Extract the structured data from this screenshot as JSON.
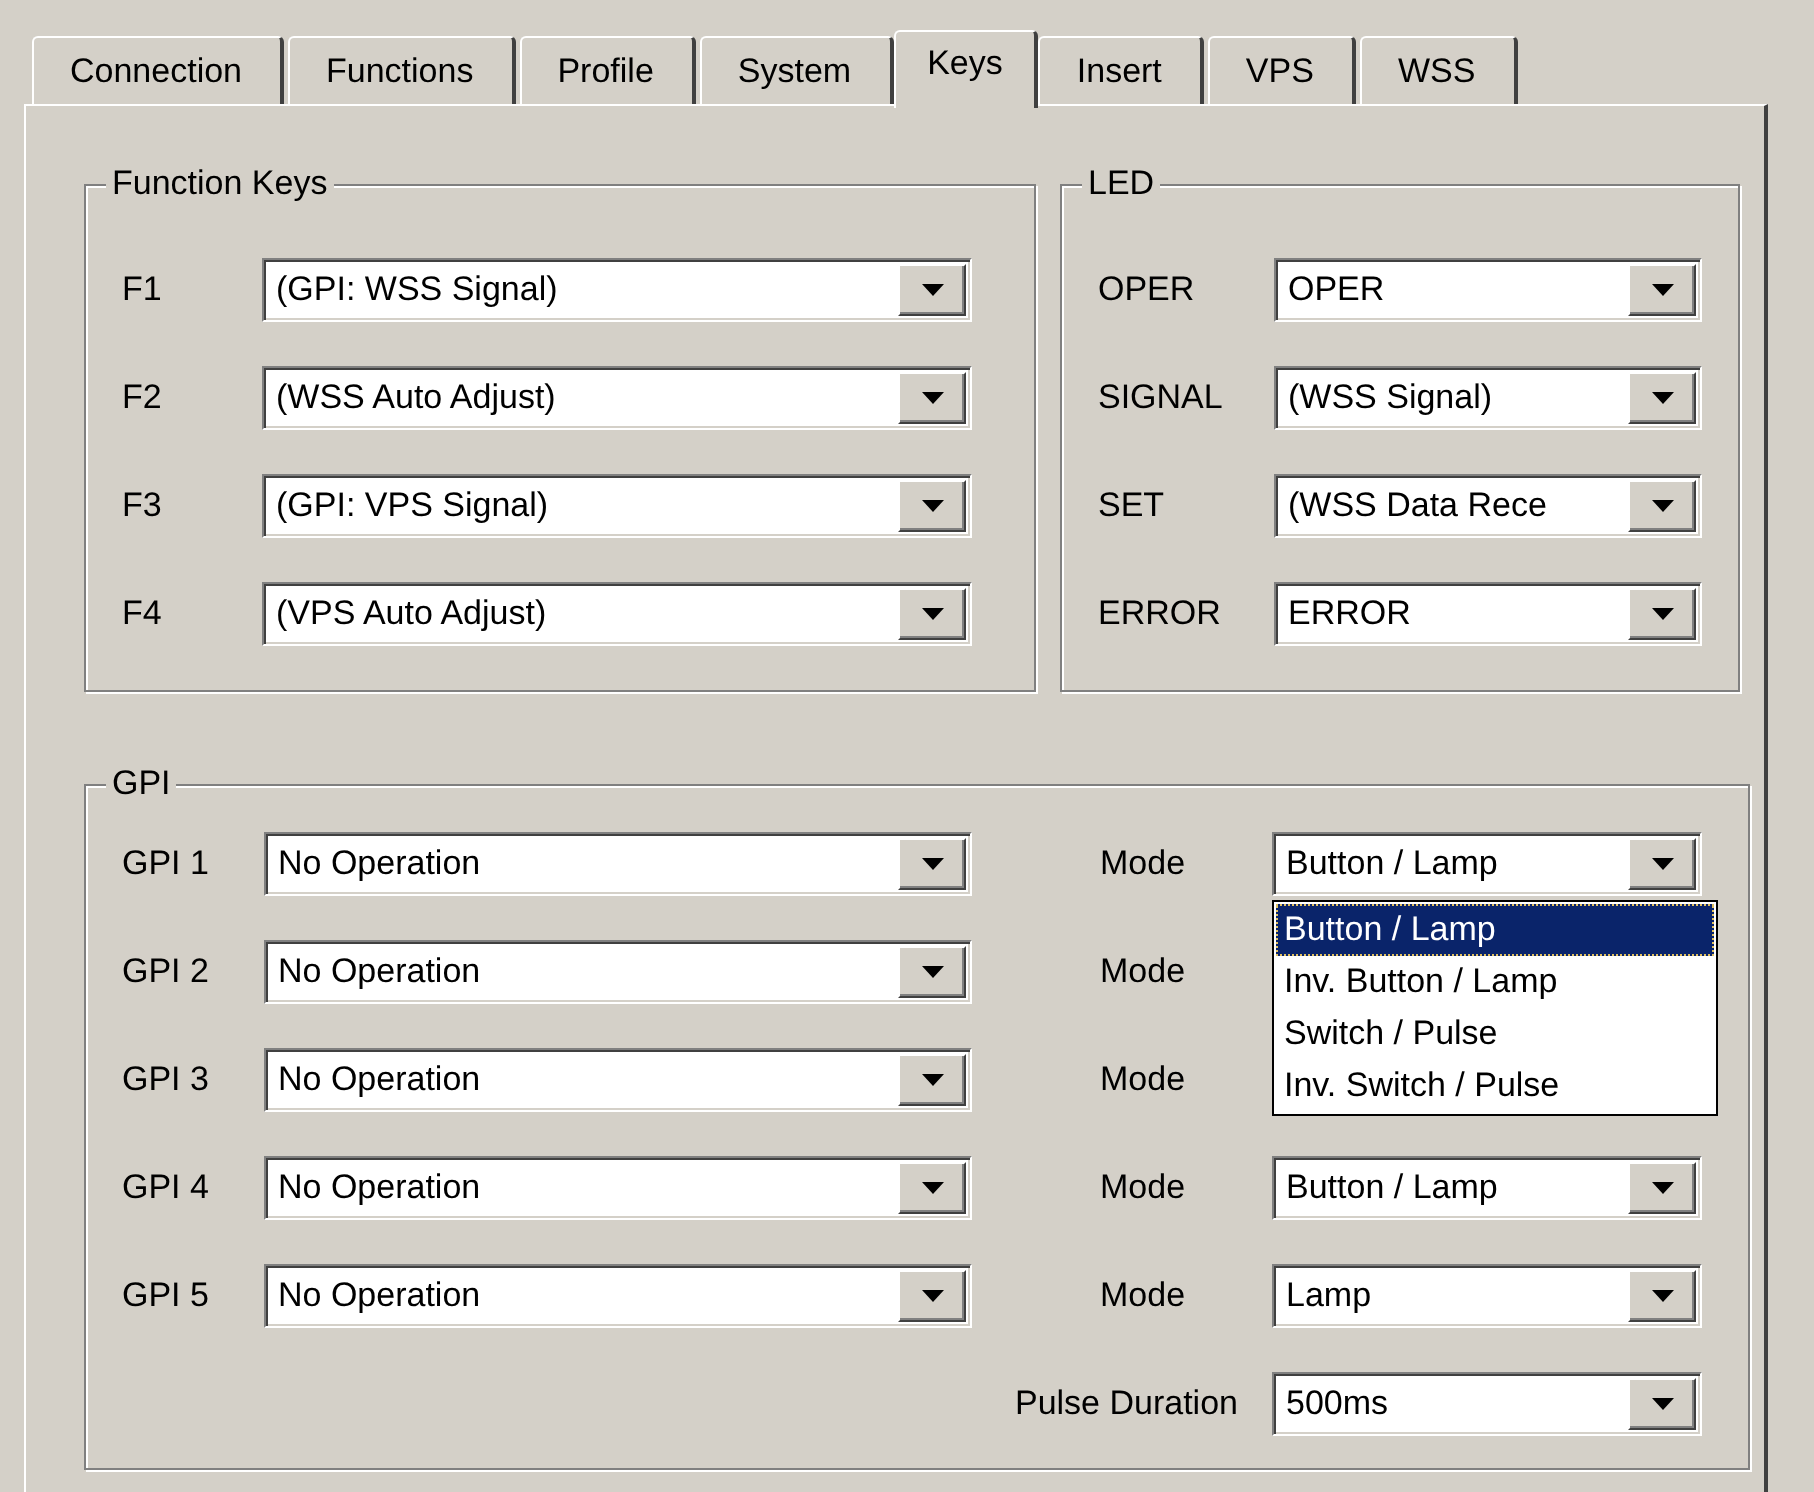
{
  "tabs": [
    {
      "label": "Connection",
      "selected": false
    },
    {
      "label": "Functions",
      "selected": false
    },
    {
      "label": "Profile",
      "selected": false
    },
    {
      "label": "System",
      "selected": false
    },
    {
      "label": "Keys",
      "selected": true
    },
    {
      "label": "Insert",
      "selected": false
    },
    {
      "label": "VPS",
      "selected": false
    },
    {
      "label": "WSS",
      "selected": false
    }
  ],
  "function_keys": {
    "title": "Function Keys",
    "rows": [
      {
        "label": "F1",
        "value": "(GPI: WSS Signal)"
      },
      {
        "label": "F2",
        "value": "(WSS Auto Adjust)"
      },
      {
        "label": "F3",
        "value": "(GPI: VPS Signal)"
      },
      {
        "label": "F4",
        "value": "(VPS Auto Adjust)"
      }
    ]
  },
  "led": {
    "title": "LED",
    "rows": [
      {
        "label": "OPER",
        "value": "OPER"
      },
      {
        "label": "SIGNAL",
        "value": "(WSS Signal)"
      },
      {
        "label": "SET",
        "value": "(WSS Data Rece"
      },
      {
        "label": "ERROR",
        "value": "ERROR"
      }
    ]
  },
  "gpi": {
    "title": "GPI",
    "rows": [
      {
        "label": "GPI 1",
        "value": "No Operation",
        "mode_label": "Mode",
        "mode_value": "Button / Lamp",
        "mode_options": [
          {
            "label": "Button / Lamp",
            "selected": true
          },
          {
            "label": "Inv. Button / Lamp",
            "selected": false
          },
          {
            "label": "Switch / Pulse",
            "selected": false
          },
          {
            "label": "Inv. Switch / Pulse",
            "selected": false
          }
        ]
      },
      {
        "label": "GPI 2",
        "value": "No Operation",
        "mode_label": "Mode"
      },
      {
        "label": "GPI 3",
        "value": "No Operation",
        "mode_label": "Mode"
      },
      {
        "label": "GPI 4",
        "value": "No Operation",
        "mode_label": "Mode",
        "mode_value": "Button / Lamp"
      },
      {
        "label": "GPI 5",
        "value": "No Operation",
        "mode_label": "Mode",
        "mode_value": "Lamp"
      }
    ],
    "pulse_duration": {
      "label": "Pulse Duration",
      "value": "500ms"
    }
  }
}
